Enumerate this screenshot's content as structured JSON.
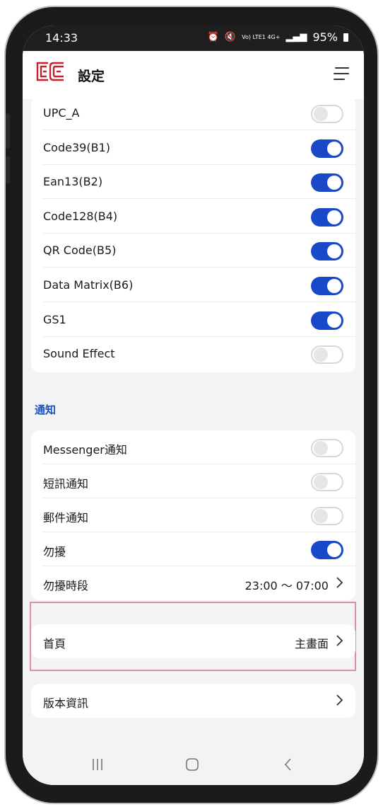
{
  "status": {
    "time": "14:33",
    "signal": "Vo) LTE1 4G+",
    "battery": "95%"
  },
  "header": {
    "title": "設定"
  },
  "barcodes": {
    "items": [
      {
        "label": "UPC_A",
        "on": false
      },
      {
        "label": "Code39(B1)",
        "on": true
      },
      {
        "label": "Ean13(B2)",
        "on": true
      },
      {
        "label": "Code128(B4)",
        "on": true
      },
      {
        "label": "QR Code(B5)",
        "on": true
      },
      {
        "label": "Data Matrix(B6)",
        "on": true
      },
      {
        "label": "GS1",
        "on": true
      },
      {
        "label": "Sound Effect",
        "on": false
      }
    ]
  },
  "notifications": {
    "title": "通知",
    "items": [
      {
        "label": "Messenger通知",
        "on": false
      },
      {
        "label": "短訊通知",
        "on": false
      },
      {
        "label": "郵件通知",
        "on": false
      },
      {
        "label": "勿擾",
        "on": true
      }
    ],
    "dnd_period": {
      "label": "勿擾時段",
      "value": "23:00 ～ 07:00"
    }
  },
  "home": {
    "label": "首頁",
    "value": "主畫面"
  },
  "version": {
    "label": "版本資訊"
  },
  "colors": {
    "accent": "#1948c9",
    "section": "#1d4fb3",
    "highlight": "#e0909c",
    "logo": "#c8202f"
  }
}
